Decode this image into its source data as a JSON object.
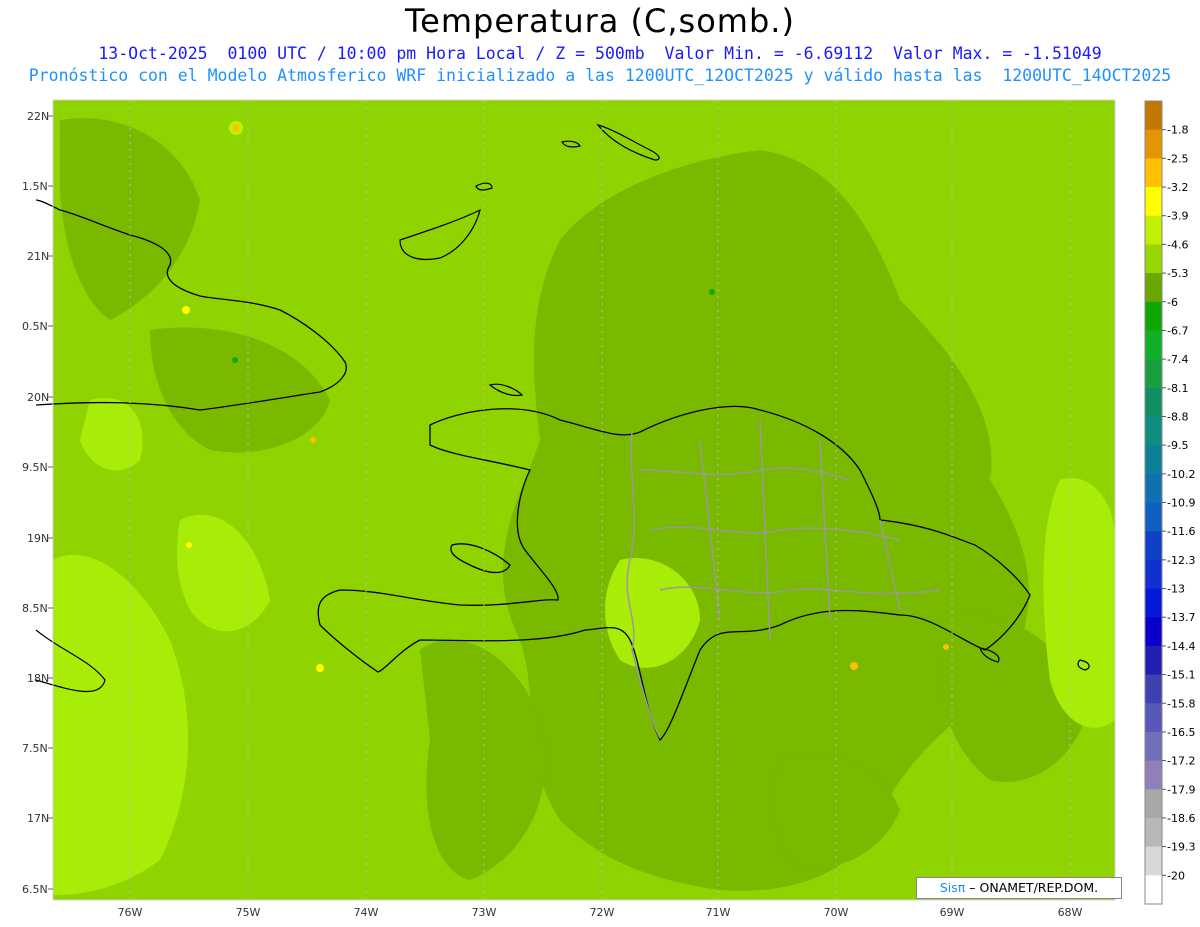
{
  "title": "Temperatura (C,somb.)",
  "subtitle1": "13-Oct-2025  0100 UTC / 10:00 pm Hora Local / Z = 500mb  Valor Min. = -6.69112  Valor Max. = -1.51049",
  "subtitle2": "Pronóstico con el Modelo Atmosferico WRF inicializado a las 1200UTC_12OCT2025 y válido hasta las  1200UTC_14OCT2025",
  "lat_labels": [
    "22N",
    "1.5N",
    "21N",
    "0.5N",
    "20N",
    "9.5N",
    "19N",
    "8.5N",
    "18N",
    "7.5N",
    "17N",
    "6.5N"
  ],
  "lon_labels": [
    "76W",
    "75W",
    "74W",
    "73W",
    "72W",
    "71W",
    "70W",
    "69W",
    "68W"
  ],
  "colorbar": {
    "labels": [
      "-1.8",
      "-2.5",
      "-3.2",
      "-3.9",
      "-4.6",
      "-5.3",
      "-6",
      "-6.7",
      "-7.4",
      "-8.1",
      "-8.8",
      "-9.5",
      "-10.2",
      "-10.9",
      "-11.6",
      "-12.3",
      "-13",
      "-13.7",
      "-14.4",
      "-15.1",
      "-15.8",
      "-16.5",
      "-17.2",
      "-17.9",
      "-18.6",
      "-19.3",
      "-20"
    ],
    "colors": [
      "#c07800",
      "#e49400",
      "#ffc000",
      "#ffff00",
      "#c2f000",
      "#98d800",
      "#6aa800",
      "#10a800",
      "#10b028",
      "#18a040",
      "#109060",
      "#108c80",
      "#0c8098",
      "#1070b0",
      "#1060c0",
      "#1040c8",
      "#1030d0",
      "#0818d8",
      "#0800c8",
      "#2020b0",
      "#4040b0",
      "#5858b8",
      "#7070b8",
      "#9080b8",
      "#a8a8a8",
      "#b8b8b8",
      "#d8d8d8",
      "#ffffff"
    ]
  },
  "map_colors": {
    "base": "#8fd400",
    "dark": "#78b800",
    "light": "#a8ec08",
    "coast": "#000000",
    "province": "#9a9a9a"
  },
  "credit": {
    "brand": "Sisπ",
    "text": "– ONAMET/REP.DOM."
  }
}
